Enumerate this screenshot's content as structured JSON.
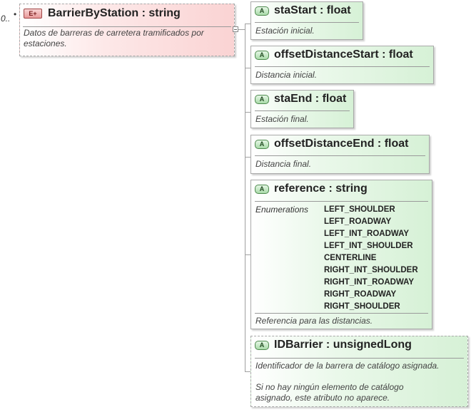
{
  "element": {
    "multiplicity": "0..",
    "multiplicity_dot": "•",
    "badge": "E+",
    "title": "BarrierByStation : string",
    "description": "Datos de barreras de carretera tramificados por estaciones."
  },
  "attributes": [
    {
      "badge": "A",
      "title": "staStart : float",
      "description": "Estación inicial."
    },
    {
      "badge": "A",
      "title": "offsetDistanceStart : float",
      "description": "Distancia inicial."
    },
    {
      "badge": "A",
      "title": "staEnd : float",
      "description": "Estación final."
    },
    {
      "badge": "A",
      "title": "offsetDistanceEnd : float",
      "description": "Distancia final."
    },
    {
      "badge": "A",
      "title": "reference : string",
      "enum_label": "Enumerations",
      "enumerations": [
        "LEFT_SHOULDER",
        "LEFT_ROADWAY",
        "LEFT_INT_ROADWAY",
        "LEFT_INT_SHOULDER",
        "CENTERLINE",
        "RIGHT_INT_SHOULDER",
        "RIGHT_INT_ROADWAY",
        "RIGHT_ROADWAY",
        "RIGHT_SHOULDER"
      ],
      "description": "Referencia para las distancias."
    },
    {
      "badge": "A",
      "title": "IDBarrier : unsignedLong",
      "description": "Identificador de la barrera de catálogo asignada.",
      "description2": "Si no hay ningún elemento de catálogo asignado, este atributo no aparece."
    }
  ]
}
